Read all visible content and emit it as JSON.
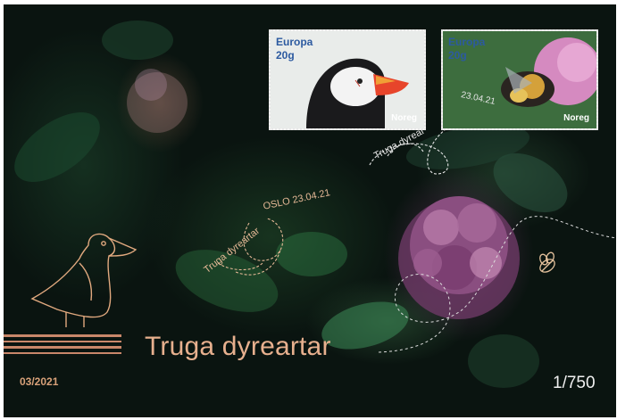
{
  "stamps": [
    {
      "heading": "Europa",
      "value": "20g",
      "country": "Noreg"
    },
    {
      "heading": "Europa",
      "value": "20g",
      "country": "Noreg"
    }
  ],
  "postmark": {
    "location_date": "OSLO 23.04.21",
    "caption": "Truga dyreartar",
    "stamp_location_date": "23.04.21",
    "stamp_caption": "Truga dyrear"
  },
  "cover": {
    "title": "Truga dyreartar",
    "issue": "03/2021",
    "edition": "1/750"
  },
  "colors": {
    "copper": "#d8a179",
    "stamp_blue": "#2c5aa0"
  }
}
